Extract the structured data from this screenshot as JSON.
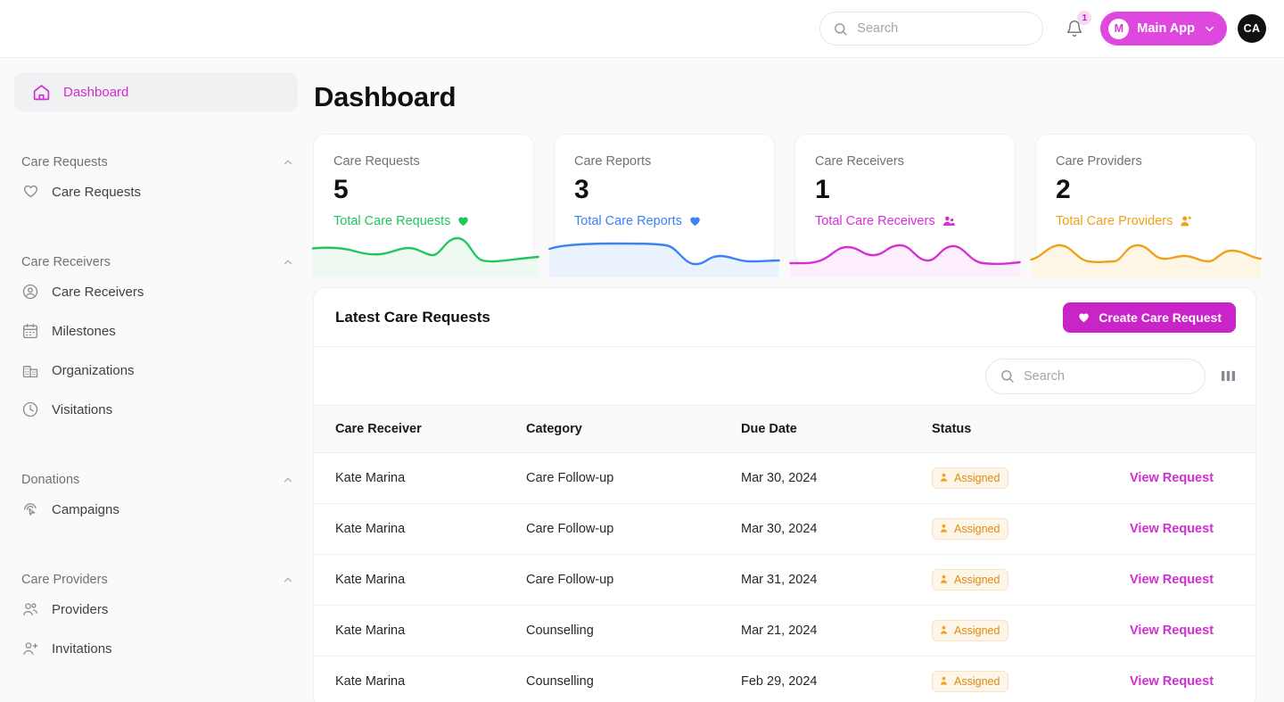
{
  "header": {
    "search_placeholder": "Search",
    "search_value": "",
    "notification_count": "1",
    "app_initial": "M",
    "app_label": "Main App",
    "user_initials": "CA"
  },
  "sidebar": {
    "active": {
      "label": "Dashboard",
      "icon": "home-icon"
    },
    "groups": [
      {
        "label": "Care Requests",
        "items": [
          {
            "label": "Care Requests",
            "icon": "heart-icon"
          }
        ]
      },
      {
        "label": "Care Receivers",
        "items": [
          {
            "label": "Care Receivers",
            "icon": "user-circle-icon"
          },
          {
            "label": "Milestones",
            "icon": "calendar-icon"
          },
          {
            "label": "Organizations",
            "icon": "building-icon"
          },
          {
            "label": "Visitations",
            "icon": "clock-icon"
          }
        ]
      },
      {
        "label": "Donations",
        "items": [
          {
            "label": "Campaigns",
            "icon": "cursor-click-icon"
          }
        ]
      },
      {
        "label": "Care Providers",
        "items": [
          {
            "label": "Providers",
            "icon": "users-icon"
          },
          {
            "label": "Invitations",
            "icon": "user-plus-icon"
          }
        ]
      }
    ]
  },
  "main": {
    "page_title": "Dashboard",
    "cards": [
      {
        "title": "Care Requests",
        "value": "5",
        "footer": "Total Care Requests",
        "icon": "heart-icon",
        "color": "#22c55e",
        "fill": "#eefaf1"
      },
      {
        "title": "Care Reports",
        "value": "3",
        "footer": "Total Care Reports",
        "icon": "heart-icon",
        "color": "#3b82f6",
        "fill": "#eaf2fe"
      },
      {
        "title": "Care Receivers",
        "value": "1",
        "footer": "Total Care Receivers",
        "icon": "users-icon",
        "color": "#d62fd6",
        "fill": "#fdeefd"
      },
      {
        "title": "Care Providers",
        "value": "2",
        "footer": "Total Care Providers",
        "icon": "user-plus-icon",
        "color": "#f0a019",
        "fill": "#fdf6e5"
      }
    ],
    "panel": {
      "title": "Latest Care Requests",
      "create_label": "Create Care Request",
      "search_placeholder": "Search",
      "search_value": "",
      "columns": [
        "Care Receiver",
        "Category",
        "Due Date",
        "Status",
        ""
      ],
      "action_label": "View Request",
      "rows": [
        {
          "receiver": "Kate Marina",
          "category": "Care Follow-up",
          "due": "Mar 30, 2024",
          "status": "Assigned"
        },
        {
          "receiver": "Kate Marina",
          "category": "Care Follow-up",
          "due": "Mar 30, 2024",
          "status": "Assigned"
        },
        {
          "receiver": "Kate Marina",
          "category": "Care Follow-up",
          "due": "Mar 31, 2024",
          "status": "Assigned"
        },
        {
          "receiver": "Kate Marina",
          "category": "Counselling",
          "due": "Mar 21, 2024",
          "status": "Assigned"
        },
        {
          "receiver": "Kate Marina",
          "category": "Counselling",
          "due": "Feb 29, 2024",
          "status": "Assigned"
        }
      ]
    }
  },
  "chart_data": [
    {
      "type": "area",
      "title": "Total Care Requests",
      "series": [
        {
          "name": "Care Requests",
          "values": [
            30,
            28,
            30,
            40,
            42,
            38,
            30,
            34,
            36,
            26,
            14,
            62,
            72,
            60,
            28,
            12,
            14,
            18,
            20
          ]
        }
      ],
      "color": "#22c55e",
      "grid": false
    },
    {
      "type": "area",
      "title": "Total Care Reports",
      "series": [
        {
          "name": "Care Reports",
          "values": [
            30,
            34,
            36,
            36,
            36,
            38,
            40,
            40,
            36,
            18,
            6,
            10,
            26,
            28,
            20,
            14,
            14,
            16,
            16
          ]
        }
      ],
      "color": "#3b82f6",
      "grid": false
    },
    {
      "type": "area",
      "title": "Total Care Receivers",
      "series": [
        {
          "name": "Care Receivers",
          "values": [
            4,
            6,
            14,
            30,
            40,
            36,
            30,
            40,
            46,
            34,
            16,
            10,
            22,
            44,
            46,
            38,
            24,
            12,
            8
          ]
        }
      ],
      "color": "#d62fd6",
      "grid": false
    },
    {
      "type": "area",
      "title": "Total Care Providers",
      "series": [
        {
          "name": "Care Providers",
          "values": [
            28,
            44,
            46,
            34,
            16,
            10,
            22,
            44,
            42,
            26,
            20,
            24,
            18,
            10,
            16,
            34,
            38,
            26,
            18
          ]
        }
      ],
      "color": "#f0a019",
      "grid": false
    }
  ]
}
